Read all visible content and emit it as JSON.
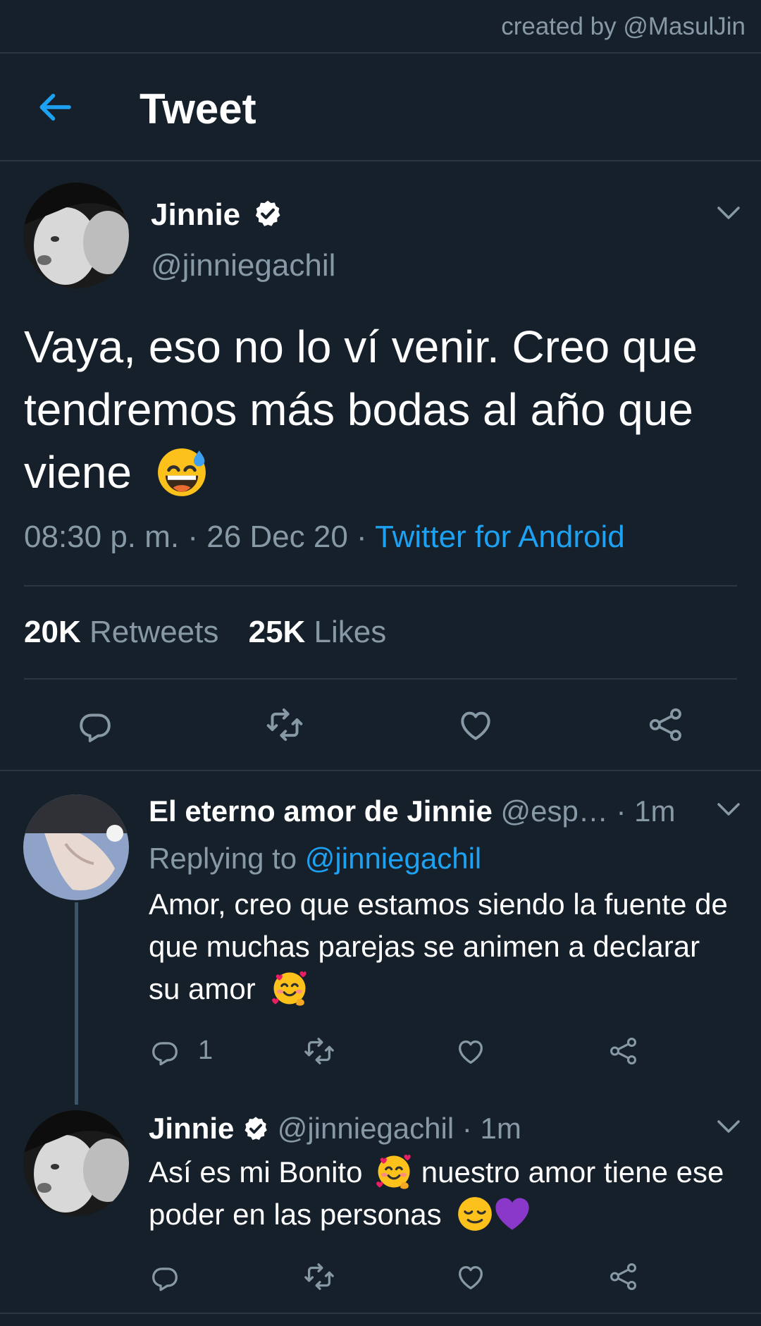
{
  "credit": "created by @MasulJin",
  "header": {
    "title": "Tweet"
  },
  "tweet": {
    "author_name": "Jinnie",
    "author_handle": "@jinniegachil",
    "text": "Vaya, eso no lo ví venir. Creo que tendremos más bodas al año que viene",
    "time": "08:30 p. m. · 26 Dec 20 · ",
    "source": "Twitter for Android",
    "retweets_count": "20K",
    "retweets_label": " Retweets",
    "likes_count": "25K",
    "likes_label": " Likes"
  },
  "replies": [
    {
      "author_name": "El eterno amor de Jinnie",
      "author_handle": "@esp…",
      "time": " · 1m",
      "replying_prefix": "Replying to ",
      "replying_handle": "@jinniegachil",
      "text": "Amor, creo que estamos siendo la fuente de que muchas parejas se animen a declarar su amor",
      "reply_count": "1"
    },
    {
      "author_name": "Jinnie",
      "author_handle": "@jinniegachil",
      "time": " · 1m",
      "text_part1": "Así es mi Bonito",
      "text_part2": " nuestro amor tiene ese poder en las personas"
    }
  ],
  "colors": {
    "background": "#15202b",
    "accent": "#1da1f2",
    "muted": "#8899a6",
    "divider": "#2a3743"
  },
  "icons": [
    "back-arrow-icon",
    "verified-badge-icon",
    "chevron-down-icon",
    "reply-icon",
    "retweet-icon",
    "like-icon",
    "share-icon",
    "sweat-smile-emoji",
    "smiling-hearts-emoji",
    "relieved-emoji",
    "purple-heart-emoji"
  ]
}
